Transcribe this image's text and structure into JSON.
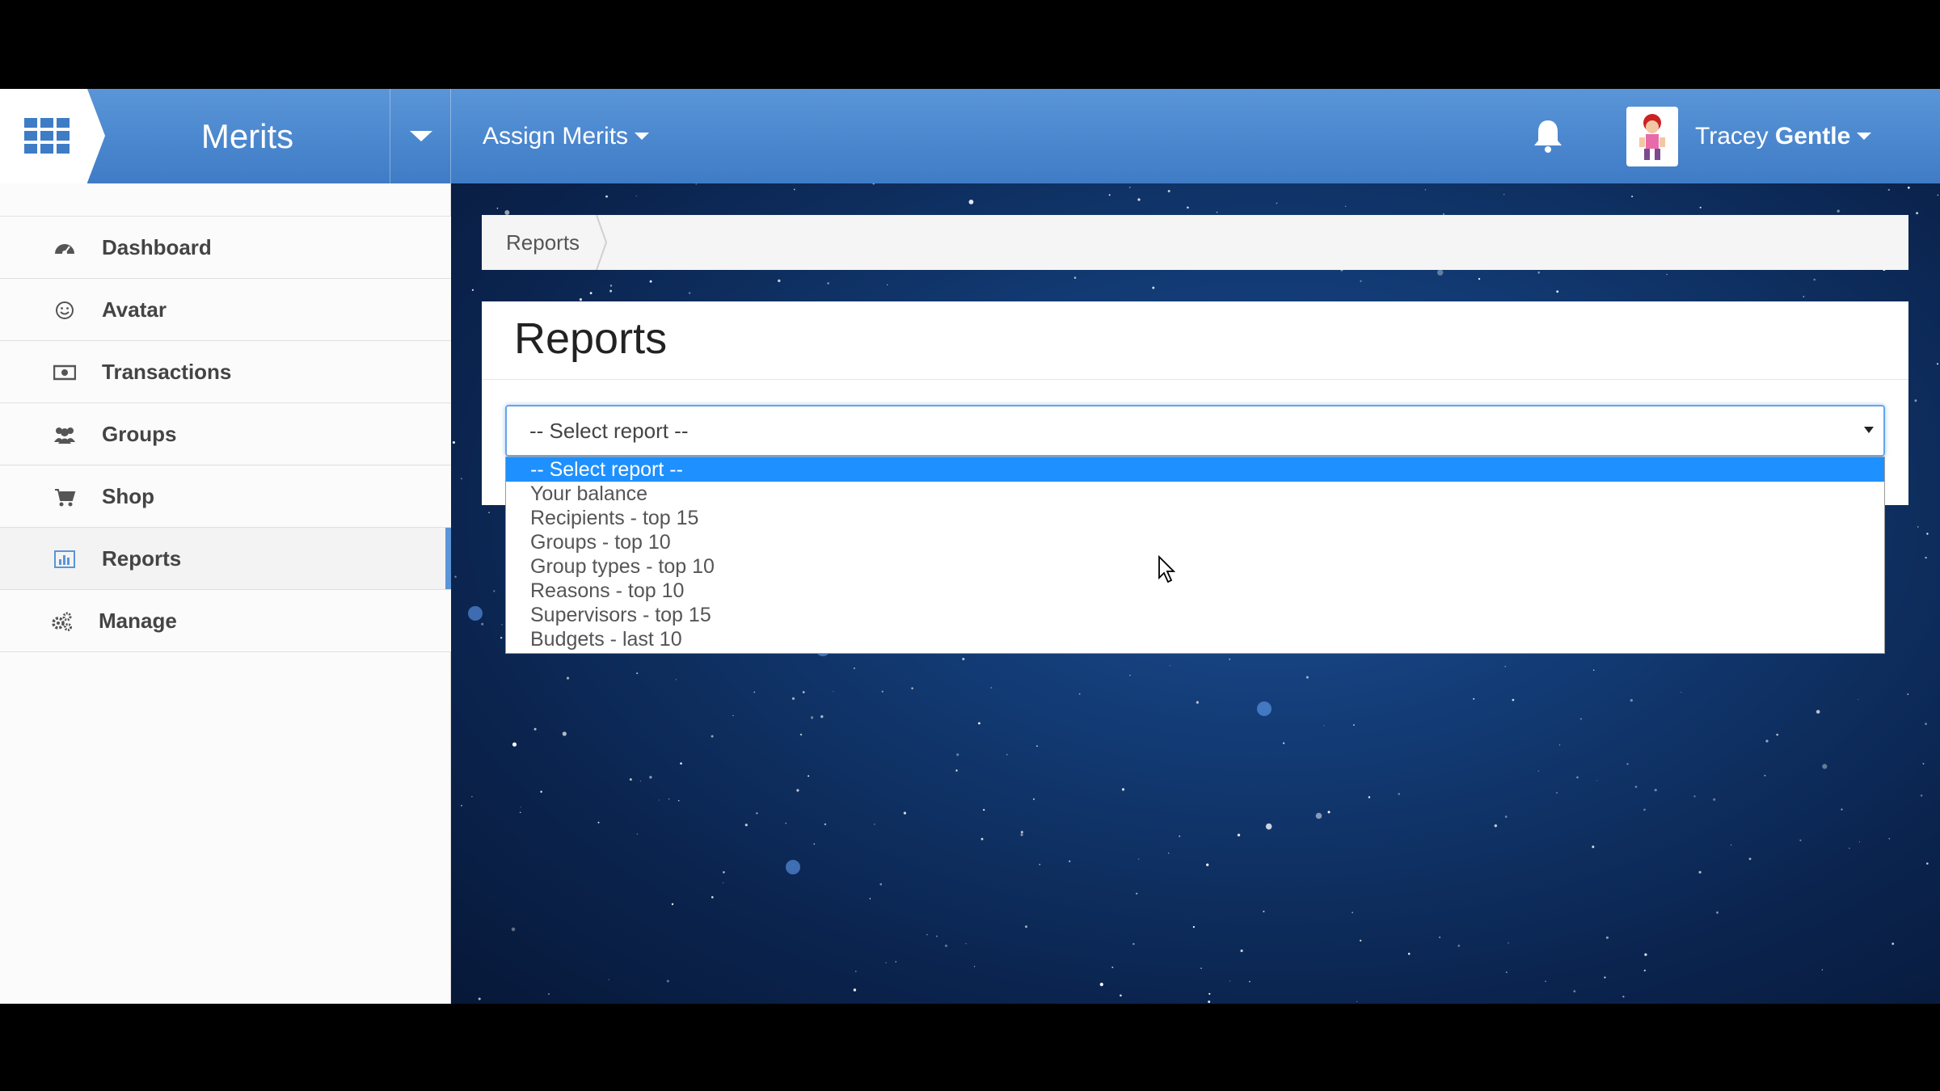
{
  "header": {
    "brand": "Merits",
    "assign_label": "Assign Merits",
    "user_first": "Tracey",
    "user_last": "Gentle"
  },
  "sidebar": {
    "items": [
      {
        "label": "Dashboard",
        "icon": "dashboard-icon"
      },
      {
        "label": "Avatar",
        "icon": "smiley-icon"
      },
      {
        "label": "Transactions",
        "icon": "money-icon"
      },
      {
        "label": "Groups",
        "icon": "users-icon"
      },
      {
        "label": "Shop",
        "icon": "cart-icon"
      },
      {
        "label": "Reports",
        "icon": "bar-chart-icon",
        "active": true
      },
      {
        "label": "Manage",
        "icon": "gears-icon"
      }
    ]
  },
  "breadcrumb": {
    "current": "Reports"
  },
  "page": {
    "title": "Reports"
  },
  "report_select": {
    "value": "-- Select report --",
    "options": [
      "-- Select report --",
      "Your balance",
      "Recipients - top 15",
      "Groups - top 10",
      "Group types - top 10",
      "Reasons - top 10",
      "Supervisors - top 15",
      "Budgets - last 10"
    ],
    "highlighted_index": 0
  },
  "colors": {
    "header_blue": "#4a88d0",
    "highlight": "#1e90ff",
    "active_bar": "#5a95d8"
  }
}
